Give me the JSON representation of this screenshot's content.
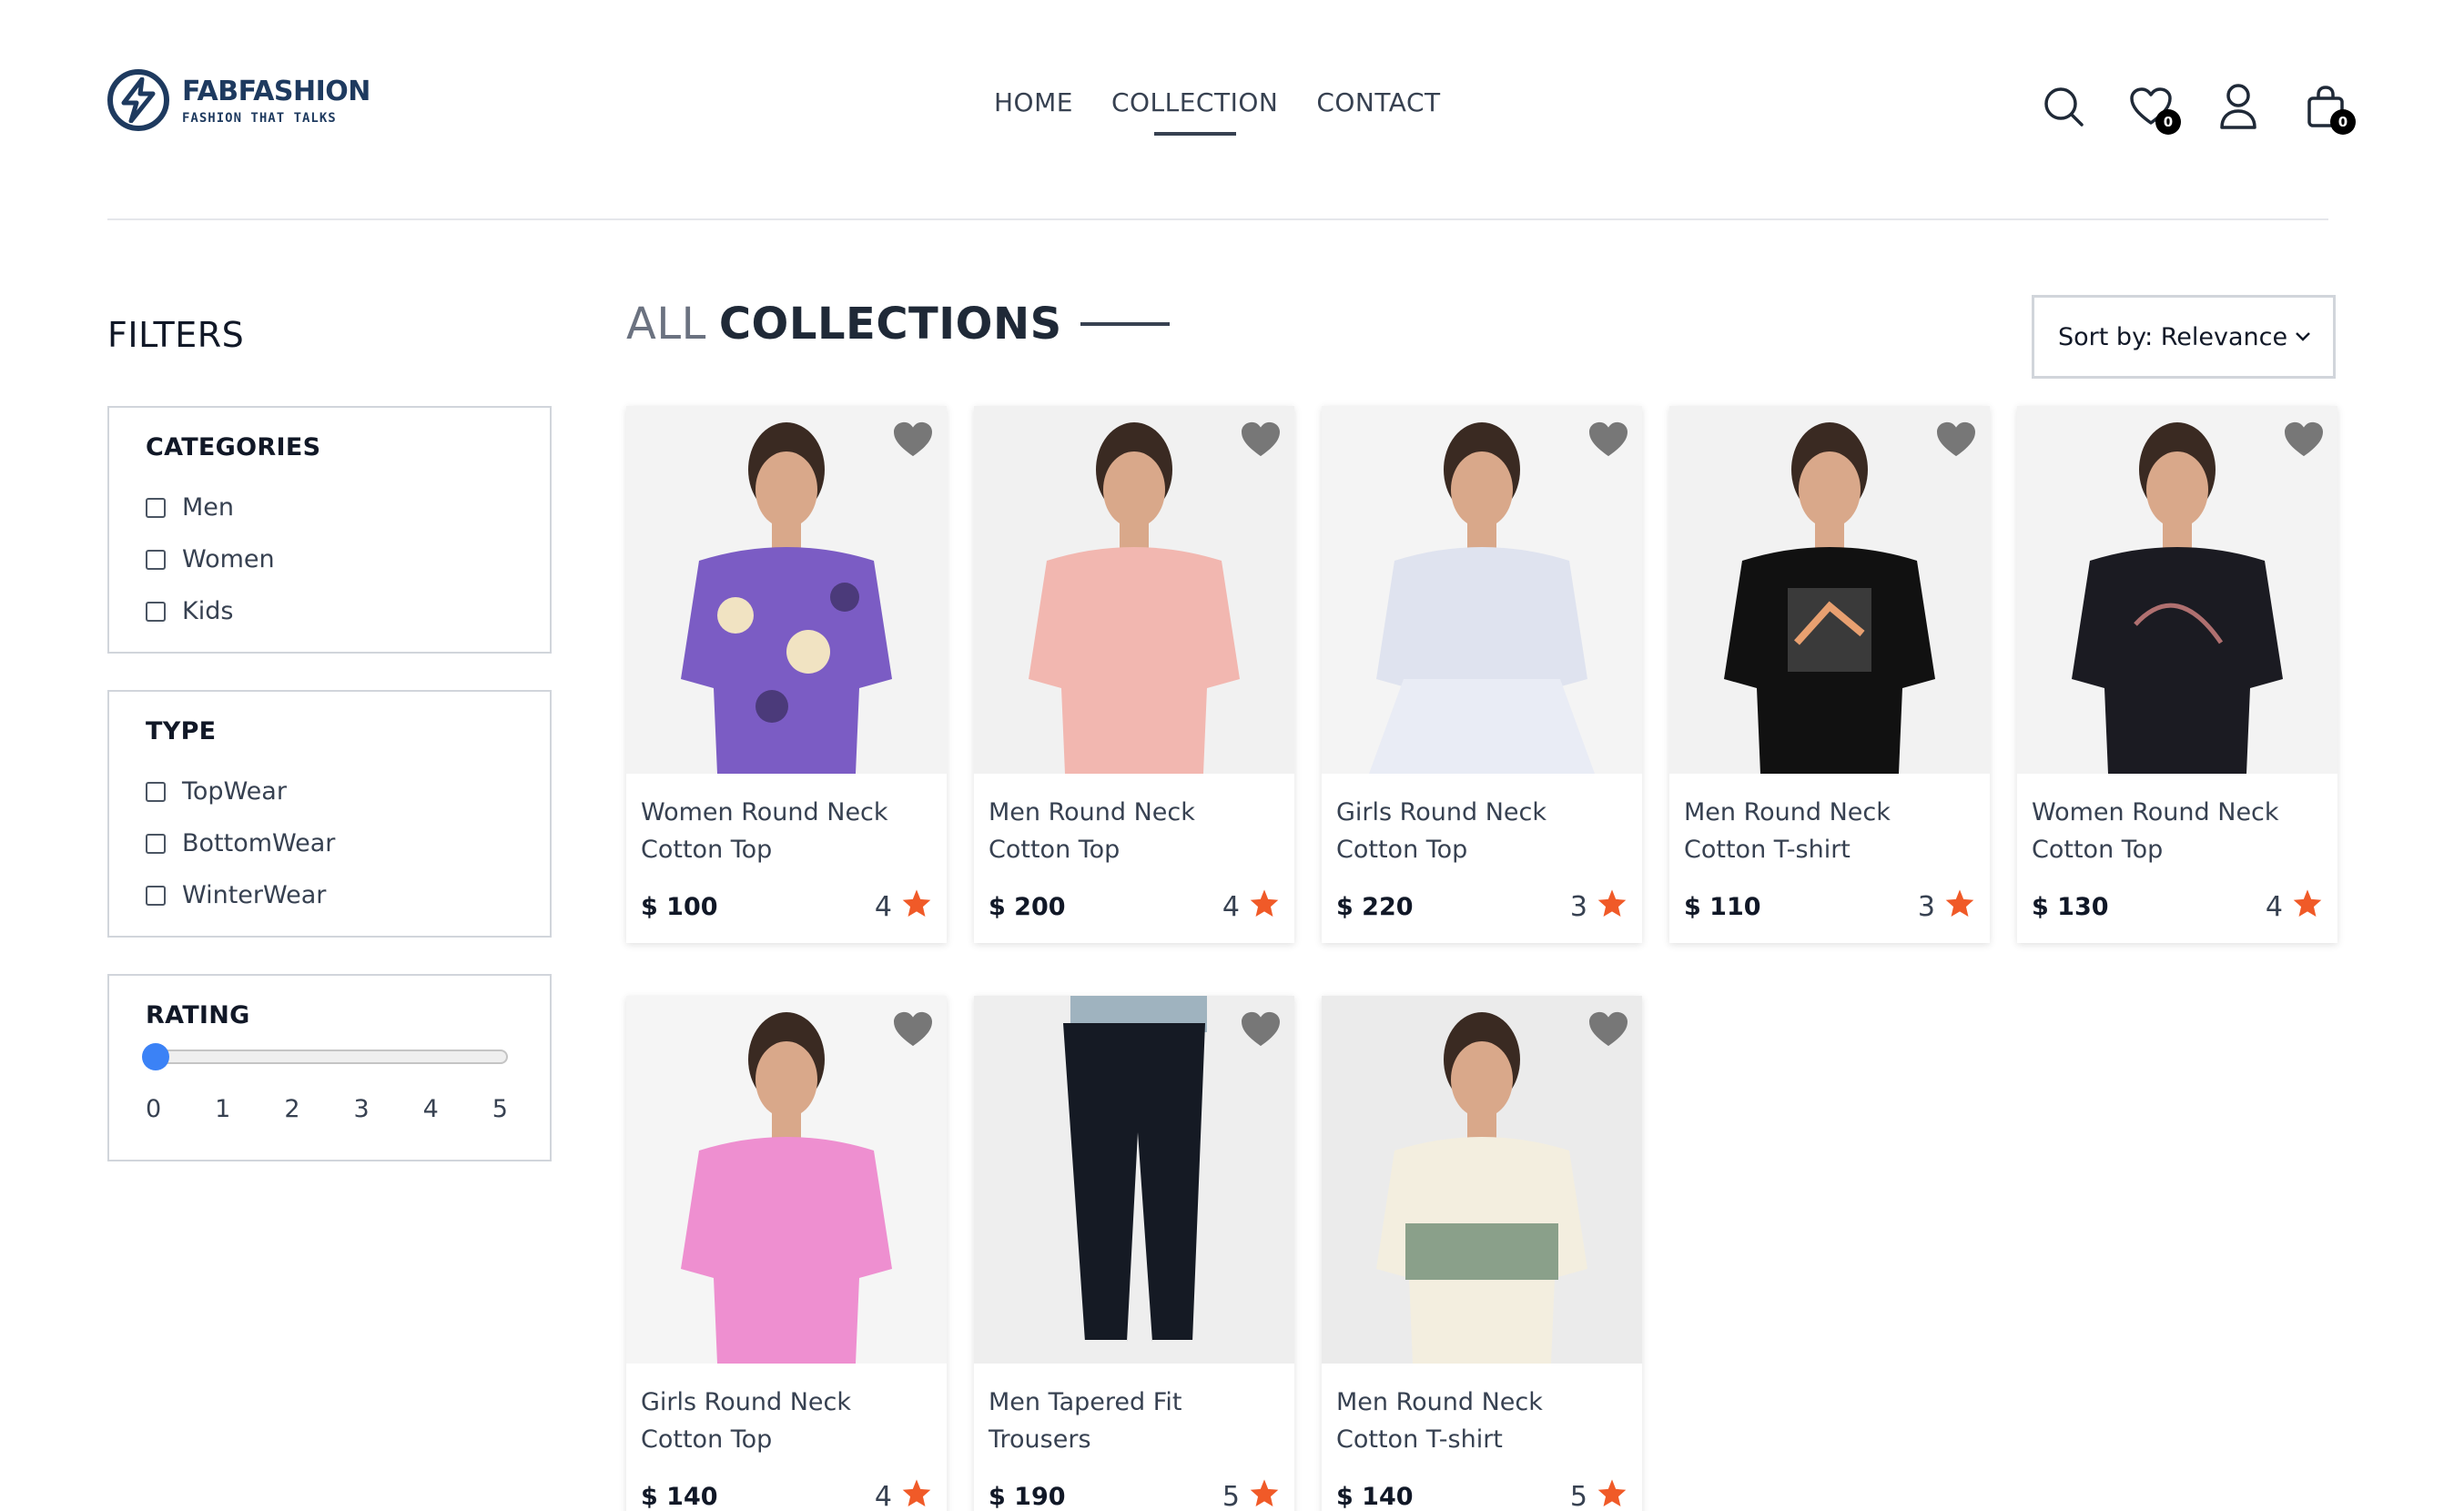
{
  "brand": {
    "name": "FABFASHION",
    "tagline": "FASHION THAT TALKS"
  },
  "nav": {
    "items": [
      "HOME",
      "COLLECTION",
      "CONTACT"
    ],
    "active": "COLLECTION"
  },
  "header_icons": {
    "search": "search-icon",
    "wishlist": "heart-icon",
    "wishlist_count": "0",
    "account": "user-icon",
    "cart": "bag-icon",
    "cart_count": "0"
  },
  "filters": {
    "title": "FILTERS",
    "categories": {
      "title": "CATEGORIES",
      "options": [
        "Men",
        "Women",
        "Kids"
      ]
    },
    "type": {
      "title": "TYPE",
      "options": [
        "TopWear",
        "BottomWear",
        "WinterWear"
      ]
    },
    "rating": {
      "title": "RATING",
      "value": 0,
      "labels": [
        "0",
        "1",
        "2",
        "3",
        "4",
        "5"
      ]
    }
  },
  "main": {
    "title_light": "ALL",
    "title_bold": "COLLECTIONS",
    "sort": "Sort by: Relevance"
  },
  "products": [
    {
      "name": "Women Round Neck Cotton Top",
      "price": "$ 100",
      "rating": "4",
      "bg": "#f3f3f3",
      "color": "#7b5cc4"
    },
    {
      "name": "Men Round Neck Cotton Top",
      "price": "$ 200",
      "rating": "4",
      "bg": "#f1f1f1",
      "color": "#f2b7b0"
    },
    {
      "name": "Girls Round Neck Cotton Top",
      "price": "$ 220",
      "rating": "3",
      "bg": "#f4f4f4",
      "color": "#dfe3ef"
    },
    {
      "name": "Men Round Neck Cotton T-shirt",
      "price": "$ 110",
      "rating": "3",
      "bg": "#f2f2f2",
      "color": "#111111"
    },
    {
      "name": "Women Round Neck Cotton Top",
      "price": "$ 130",
      "rating": "4",
      "bg": "#f3f3f3",
      "color": "#1b1b22"
    },
    {
      "name": "Girls Round Neck Cotton Top",
      "price": "$ 140",
      "rating": "4",
      "bg": "#f5f5f5",
      "color": "#ee8fd0"
    },
    {
      "name": "Men Tapered Fit Trousers",
      "price": "$ 190",
      "rating": "5",
      "bg": "#eeeeee",
      "color": "#151a24"
    },
    {
      "name": "Men Round Neck Cotton T-shirt",
      "price": "$ 140",
      "rating": "5",
      "bg": "#ebebeb",
      "color": "#f3eedf"
    }
  ],
  "colors": {
    "accent": "#3b82f6",
    "star": "#f05a28",
    "heart": "#777777",
    "brand": "#1e3a5f"
  }
}
